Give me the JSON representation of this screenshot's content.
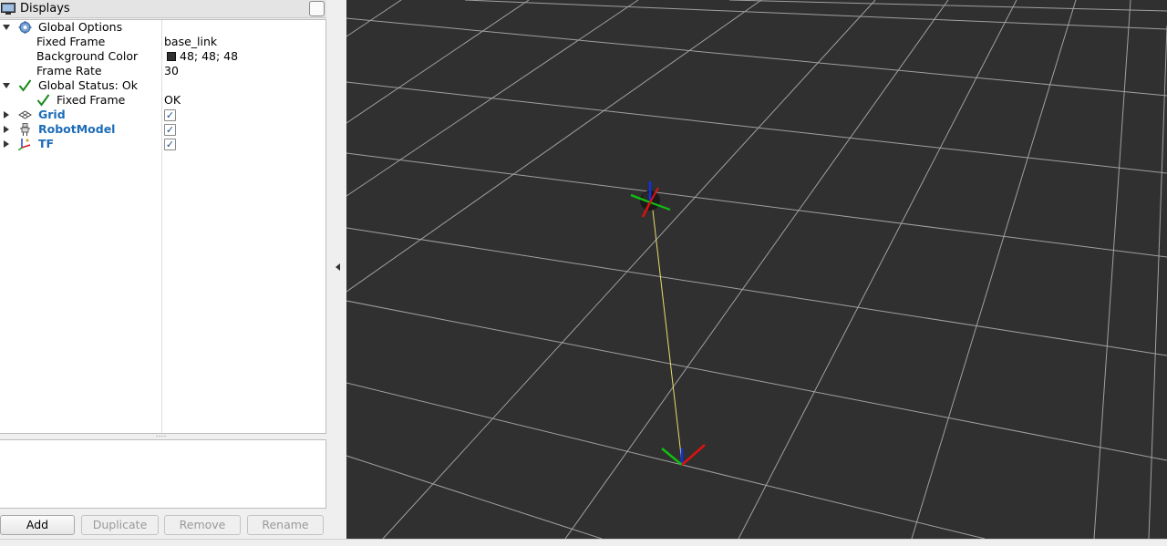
{
  "dock": {
    "title": "Displays"
  },
  "tree": {
    "global_options": {
      "label": "Global Options",
      "fixed_frame": {
        "label": "Fixed Frame",
        "value": "base_link"
      },
      "background_color": {
        "label": "Background Color",
        "value": "48; 48; 48",
        "swatch": "#303030"
      },
      "frame_rate": {
        "label": "Frame Rate",
        "value": "30"
      }
    },
    "global_status": {
      "label": "Global Status: Ok",
      "fixed_frame": {
        "label": "Fixed Frame",
        "value": "OK"
      }
    },
    "displays": [
      {
        "label": "Grid",
        "enabled": true,
        "icon": "grid-icon"
      },
      {
        "label": "RobotModel",
        "enabled": true,
        "icon": "robot-model-icon"
      },
      {
        "label": "TF",
        "enabled": true,
        "icon": "tf-axes-icon"
      }
    ]
  },
  "buttons": {
    "add": "Add",
    "duplicate": "Duplicate",
    "remove": "Remove",
    "rename": "Rename"
  },
  "colors": {
    "viewport_bg": "#303030",
    "grid_line": "#a0a0a0",
    "link_line": "#e8e06a",
    "axis_x": "#e01010",
    "axis_y": "#10c010",
    "axis_z": "#1030e0",
    "display_label": "#1d6cb8",
    "status_ok": "#1a8a1a"
  }
}
